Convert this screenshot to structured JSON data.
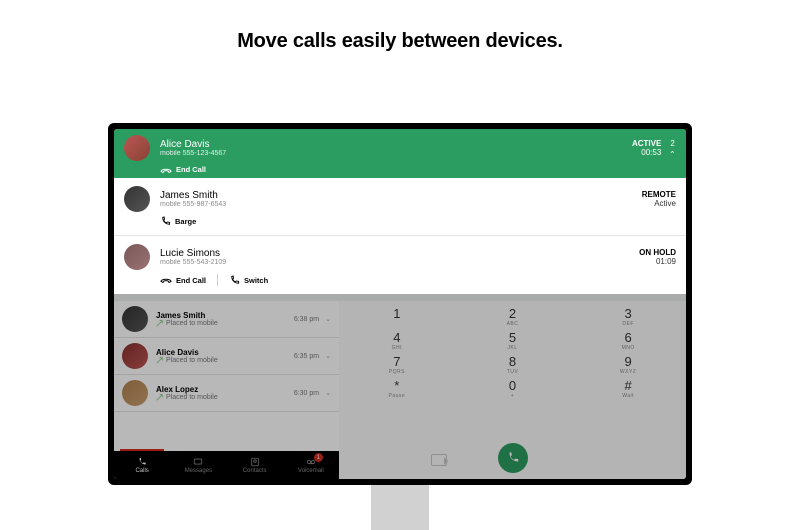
{
  "tagline": "Move calls easily between devices.",
  "active_call": {
    "name": "Alice Davis",
    "number": "mobile 555-123-4567",
    "status": "ACTIVE",
    "time": "00:53",
    "count": "2",
    "end_label": "End Call"
  },
  "second_call": {
    "name": "James Smith",
    "number": "mobile 555-987-6543",
    "status_top": "REMOTE",
    "status_bottom": "Active",
    "barge_label": "Barge"
  },
  "third_call": {
    "name": "Lucie Simons",
    "number": "mobile 555-543-2109",
    "status_top": "ON HOLD",
    "time": "01:09",
    "end_label": "End Call",
    "switch_label": "Switch"
  },
  "history": [
    {
      "name": "James Smith",
      "sub": "Placed to mobile",
      "time": "6:38 pm"
    },
    {
      "name": "Alice Davis",
      "sub": "Placed to mobile",
      "time": "6:35 pm"
    },
    {
      "name": "Alex Lopez",
      "sub": "Placed to mobile",
      "time": "6:30 pm"
    }
  ],
  "dialpad": [
    {
      "n": "1",
      "s": ""
    },
    {
      "n": "2",
      "s": "ABC"
    },
    {
      "n": "3",
      "s": "DEF"
    },
    {
      "n": "4",
      "s": "GHI"
    },
    {
      "n": "5",
      "s": "JKL"
    },
    {
      "n": "6",
      "s": "MNO"
    },
    {
      "n": "7",
      "s": "PQRS"
    },
    {
      "n": "8",
      "s": "TUV"
    },
    {
      "n": "9",
      "s": "WXYZ"
    },
    {
      "n": "*",
      "s": "Pause"
    },
    {
      "n": "0",
      "s": "+"
    },
    {
      "n": "#",
      "s": "Wait"
    }
  ],
  "nav": {
    "calls": "Calls",
    "messages": "Messages",
    "contacts": "Contacts",
    "voicemail": "Voicemail",
    "voicemail_badge": "1"
  }
}
